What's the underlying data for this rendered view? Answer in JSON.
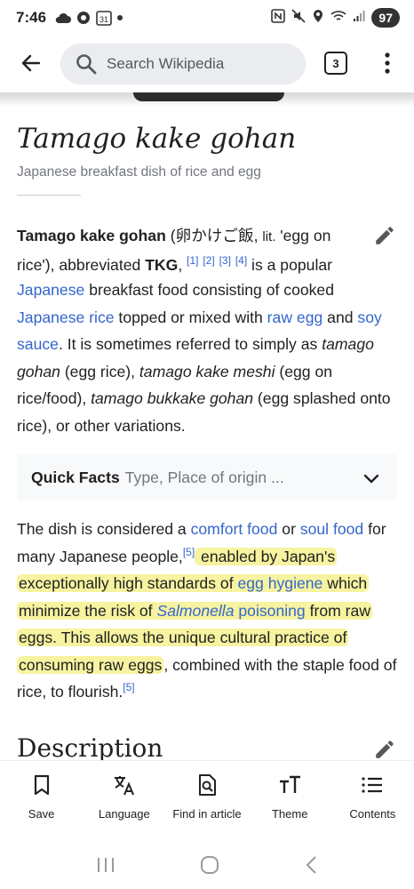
{
  "status_bar": {
    "time": "7:46",
    "calendar_day": "31",
    "battery": "97"
  },
  "search": {
    "placeholder": "Search Wikipedia"
  },
  "tabs_count": "3",
  "article": {
    "title": "Tamago kake gohan",
    "description": "Japanese breakfast dish of rice and egg",
    "intro": {
      "t_bold1": "Tamago kake gohan",
      "t1": " (",
      "t_jp": "卵かけご飯",
      "t2": ", ",
      "t_lit": "lit.",
      "t3": " 'egg on rice'), abbreviated ",
      "t_bold2": "TKG",
      "t4": ", ",
      "ref1": "[1]",
      "ref2": "[2]",
      "ref3": "[3]",
      "ref4": "[4]",
      "t5": " is a popular ",
      "link_japanese": "Japanese",
      "t6": " breakfast food consisting of cooked ",
      "link_rice": "Japanese rice",
      "t7": " topped or mixed with ",
      "link_egg": "raw egg",
      "t8": " and ",
      "link_soy": "soy sauce",
      "t9": ". It is sometimes referred to simply as ",
      "i1": "tamago gohan",
      "t10": " (egg rice), ",
      "i2": "tamago kake meshi",
      "t11": " (egg on rice/food), ",
      "i3": "tamago bukkake gohan",
      "t12": " (egg splashed onto rice), or other variations."
    },
    "quick_facts": {
      "title": "Quick Facts",
      "subtitle": "Type, Place of origin ..."
    },
    "second": {
      "t1": "The dish is considered a ",
      "link_comfort": "comfort food",
      "t2": " or ",
      "link_soul": "soul food",
      "t3": " for many Japanese people,",
      "ref5": "[5]",
      "h1": " enabled by Japan's exceptionally high standards of ",
      "link_hygiene": "egg hygiene",
      "h2": " which minimize the risk of ",
      "link_salmonella": "Salmonella",
      "link_poisoning": " poisoning",
      "h3": " from raw eggs. This allows the unique cultural practice of consuming raw eggs",
      "t4": ", combined with the staple food of rice, to flourish.",
      "ref5b": "[5]"
    },
    "section_heading": "Description"
  },
  "bottom_nav": {
    "save": "Save",
    "language": "Language",
    "find": "Find in article",
    "theme": "Theme",
    "contents": "Contents"
  },
  "colors": {
    "link": "#3366cc",
    "highlight": "#f7f3a0",
    "text": "#202122"
  }
}
